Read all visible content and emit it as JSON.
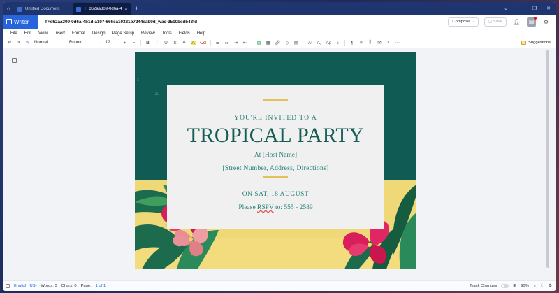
{
  "tabs": [
    {
      "label": "Untitled Document",
      "active": false
    },
    {
      "label": "TFd62aa309-0d6a-4...",
      "active": true
    }
  ],
  "app": {
    "brand": "Writer",
    "doc_name": "TFd62aa309-0d6a-4b1d-a107-666ca10321b7244eab9d_wac-3510bedb43fd",
    "compose_label": "Compose",
    "save_label": "Save",
    "accent": "#2665dc"
  },
  "menu": [
    "File",
    "Edit",
    "View",
    "Insert",
    "Format",
    "Design",
    "Page Setup",
    "Review",
    "Tools",
    "Fields",
    "Help"
  ],
  "toolbar": {
    "style": "Normal",
    "font": "Roboto",
    "size": "12",
    "suggestions_label": "Suggestions"
  },
  "document": {
    "invite": "YOU'RE INVITED TO A",
    "title": "TROPICAL PARTY",
    "host": "At [Host Name]",
    "address": "[Street Number, Address, Directions]",
    "date": "ON SAT, 18 AUGUST",
    "rsvp_prefix": "Please ",
    "rsvp_word": "RSPV",
    "rsvp_suffix": " to: 555 - 2589",
    "colors": {
      "teal": "#115b55",
      "yellow": "#efd878",
      "card": "#f0f0f0",
      "text": "#1f7f76"
    }
  },
  "status": {
    "language": "English (US)",
    "words": "Words: 0",
    "chars": "Chars: 0",
    "page_label": "Page:",
    "page_value": "1 of 1",
    "track_changes": "Track Changes",
    "zoom": "90%"
  }
}
